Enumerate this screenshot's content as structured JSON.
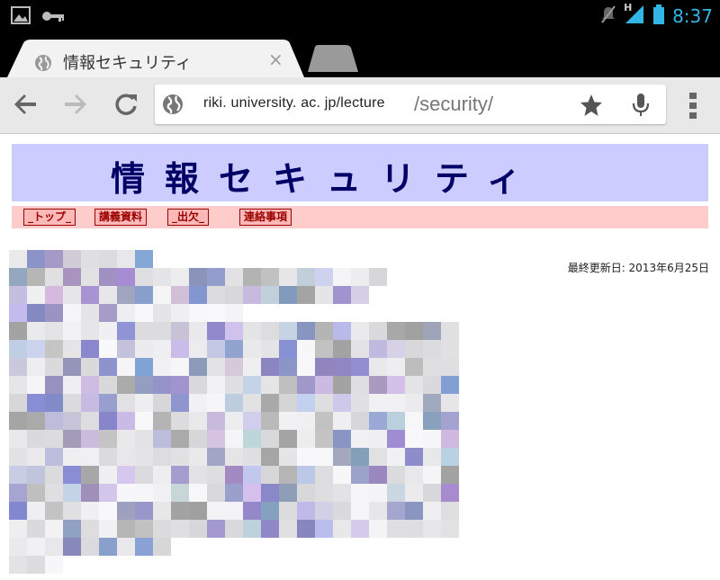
{
  "status_bar": {
    "time": "8:37",
    "network": "H",
    "left_icons": [
      "gallery-icon",
      "key-icon"
    ],
    "right_icons": [
      "mute-icon",
      "signal-icon",
      "battery-icon"
    ]
  },
  "browser": {
    "active_tab_title": "情報セキュリティ",
    "tab_close": "×",
    "url_host": "riki. university. ac. jp/lecture",
    "url_path": "/security/"
  },
  "page": {
    "banner_title": "情報セキュリティ",
    "nav": [
      "_トップ_",
      "講義資料",
      "_出欠_",
      "連絡事項"
    ],
    "last_updated": "最終更新日: 2013年6月25日"
  },
  "colors": {
    "banner_bg": "#ccccff",
    "banner_text": "#000066",
    "nav_bg": "#ffcccc",
    "nav_text": "#990000",
    "status_accent": "#33b5e5"
  }
}
